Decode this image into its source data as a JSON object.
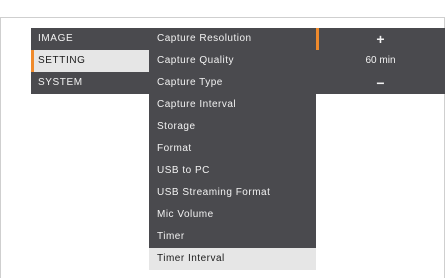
{
  "left_menu": {
    "items": [
      {
        "label": "IMAGE"
      },
      {
        "label": "SETTING"
      },
      {
        "label": "SYSTEM"
      }
    ]
  },
  "settings_menu": {
    "items": [
      {
        "label": "Capture Resolution"
      },
      {
        "label": "Capture Quality"
      },
      {
        "label": "Capture Type"
      },
      {
        "label": "Capture Interval"
      },
      {
        "label": "Storage"
      },
      {
        "label": "Format"
      },
      {
        "label": "USB to PC"
      },
      {
        "label": "USB Streaming Format"
      },
      {
        "label": "Mic Volume"
      },
      {
        "label": "Timer"
      },
      {
        "label": "Timer Interval"
      }
    ]
  },
  "value_panel": {
    "increase": "+",
    "value": "60 min",
    "decrease": "−"
  },
  "colors": {
    "accent": "#ef8a2c",
    "panel_bg": "#4a4a4e",
    "selected_bg": "#e6e6e6"
  }
}
